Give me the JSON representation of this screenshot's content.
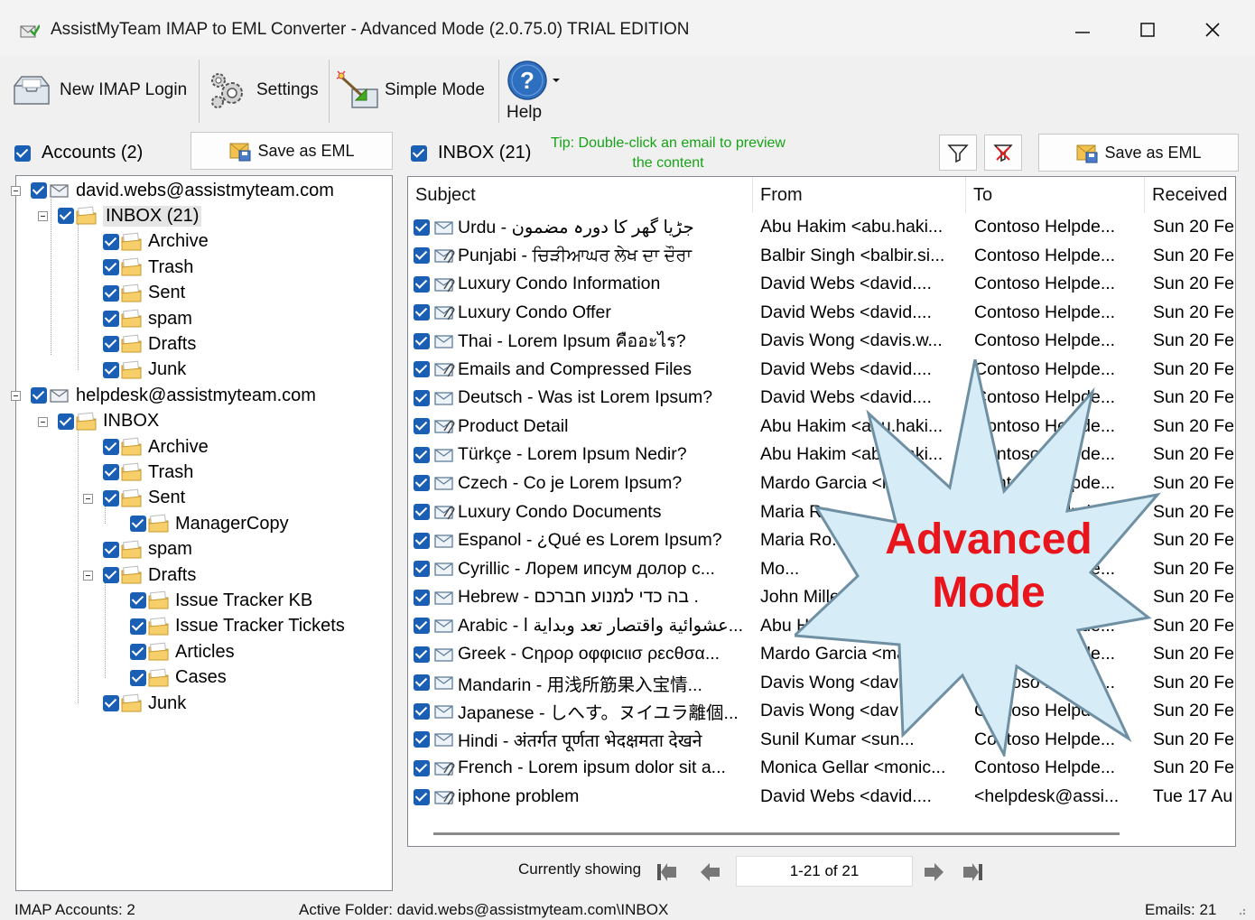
{
  "window": {
    "title": "AssistMyTeam IMAP to EML Converter - Advanced Mode (2.0.75.0) TRIAL EDITION"
  },
  "toolbar": {
    "new_imap_login": "New IMAP Login",
    "settings": "Settings",
    "simple_mode": "Simple Mode",
    "help": "Help"
  },
  "accounts_panel": {
    "header": "Accounts (2)",
    "save_label": "Save as EML",
    "tree": [
      {
        "label": "david.webs@assistmyteam.com",
        "level": 0,
        "kind": "account"
      },
      {
        "label": "INBOX (21)",
        "level": 1,
        "kind": "folder",
        "selected": true
      },
      {
        "label": "Archive",
        "level": 2,
        "kind": "folder"
      },
      {
        "label": "Trash",
        "level": 2,
        "kind": "folder"
      },
      {
        "label": "Sent",
        "level": 2,
        "kind": "folder"
      },
      {
        "label": "spam",
        "level": 2,
        "kind": "folder"
      },
      {
        "label": "Drafts",
        "level": 2,
        "kind": "folder"
      },
      {
        "label": "Junk",
        "level": 2,
        "kind": "folder"
      },
      {
        "label": "helpdesk@assistmyteam.com",
        "level": 0,
        "kind": "account"
      },
      {
        "label": "INBOX",
        "level": 1,
        "kind": "folder"
      },
      {
        "label": "Archive",
        "level": 2,
        "kind": "folder"
      },
      {
        "label": "Trash",
        "level": 2,
        "kind": "folder"
      },
      {
        "label": "Sent",
        "level": 2,
        "kind": "folder"
      },
      {
        "label": "ManagerCopy",
        "level": 3,
        "kind": "folder"
      },
      {
        "label": "spam",
        "level": 2,
        "kind": "folder"
      },
      {
        "label": "Drafts",
        "level": 2,
        "kind": "folder"
      },
      {
        "label": "Issue Tracker KB",
        "level": 3,
        "kind": "folder"
      },
      {
        "label": "Issue Tracker Tickets",
        "level": 3,
        "kind": "folder"
      },
      {
        "label": "Articles",
        "level": 3,
        "kind": "folder"
      },
      {
        "label": "Cases",
        "level": 3,
        "kind": "folder"
      },
      {
        "label": "Junk",
        "level": 2,
        "kind": "folder"
      }
    ]
  },
  "inbox_panel": {
    "header": "INBOX (21)",
    "tip": "Tip: Double-click an email to preview the content",
    "save_label": "Save as EML",
    "columns": [
      "Subject",
      "From",
      "To",
      "Received"
    ],
    "rows": [
      {
        "subject": "Urdu - جڑیا گھر کا دورہ مضمون",
        "from": "Abu Hakim <abu.haki...",
        "to": "Contoso Helpde...",
        "received": "Sun 20 Fe",
        "attach": false
      },
      {
        "subject": "Punjabi - ਚਿੜੀਆਘਰ ਲੇਖ ਦਾ ਦੌਰਾ",
        "from": "Balbir Singh <balbir.si...",
        "to": "Contoso Helpde...",
        "received": "Sun 20 Fe",
        "attach": true
      },
      {
        "subject": "Luxury Condo Information",
        "from": "David Webs <david....",
        "to": "Contoso Helpde...",
        "received": "Sun 20 Fe",
        "attach": true
      },
      {
        "subject": "Luxury Condo Offer",
        "from": "David Webs <david....",
        "to": "Contoso Helpde...",
        "received": "Sun 20 Fe",
        "attach": true
      },
      {
        "subject": "Thai - Lorem Ipsum คืออะไร?",
        "from": "Davis Wong <davis.w...",
        "to": "Contoso Helpde...",
        "received": "Sun 20 Fe",
        "attach": false
      },
      {
        "subject": "Emails and Compressed Files",
        "from": "David Webs <david....",
        "to": "Contoso Helpde...",
        "received": "Sun 20 Fe",
        "attach": true
      },
      {
        "subject": "Deutsch - Was ist Lorem Ipsum?",
        "from": "David Webs <david....",
        "to": "Contoso Helpde...",
        "received": "Sun 20 Fe",
        "attach": false
      },
      {
        "subject": "Product Detail",
        "from": "Abu Hakim <abu.haki...",
        "to": "Contoso Helpde...",
        "received": "Sun 20 Fe",
        "attach": true
      },
      {
        "subject": "Türkçe - Lorem Ipsum Nedir?",
        "from": "Abu Hakim <abu.haki...",
        "to": "Contoso Helpde...",
        "received": "Sun 20 Fe",
        "attach": false
      },
      {
        "subject": "Czech - Co je Lorem Ipsum?",
        "from": "Mardo Garcia <mar...",
        "to": "Contoso Helpde...",
        "received": "Sun 20 Fe",
        "attach": false
      },
      {
        "subject": "Luxury Condo Documents",
        "from": "Maria Ro...",
        "to": "Contoso Helpde...",
        "received": "Sun 20 Fe",
        "attach": true
      },
      {
        "subject": "Espanol - ¿Qué es Lorem Ipsum?",
        "from": "Maria Ro...",
        "to": "Contoso Helpde...",
        "received": "Sun 20 Fe",
        "attach": false
      },
      {
        "subject": "Cyrillic - Лорем ипсум долор с...",
        "from": "Mo...",
        "to": "Contoso Helpde...",
        "received": "Sun 20 Fe",
        "attach": false
      },
      {
        "subject": "Hebrew - בה כדי למנוע חברכם .",
        "from": "John Miller",
        "to": "Contoso Helpde...",
        "received": "Sun 20 Fe",
        "attach": false
      },
      {
        "subject": "Arabic - عشوائية واقتصار تعد وبداية ا...",
        "from": "Abu Hakim",
        "to": "Contoso Helpde...",
        "received": "Sun 20 Fe",
        "attach": false
      },
      {
        "subject": "Greek - Cηρορ οφφιcιισ ρεcθσα...",
        "from": "Mardo Garcia <mar",
        "to": "Contoso Helpde...",
        "received": "Sun 20 Fe",
        "attach": false
      },
      {
        "subject": "Mandarin - 用浅所筋果入宝情...",
        "from": "Davis Wong <davi",
        "to": "Contoso Helpde...",
        "received": "Sun 20 Fe",
        "attach": false
      },
      {
        "subject": "Japanese - しへす。ヌイユラ離個...",
        "from": "Davis Wong <dav",
        "to": "Contoso Helpde...",
        "received": "Sun 20 Fe",
        "attach": false
      },
      {
        "subject": "Hindi - अंतर्गत पूर्णता भेदक्षमता देखने",
        "from": "Sunil Kumar <sun...",
        "to": "Contoso Helpde...",
        "received": "Sun 20 Fe",
        "attach": false
      },
      {
        "subject": "French - Lorem ipsum dolor sit a...",
        "from": "Monica Gellar <monic...",
        "to": "Contoso Helpde...",
        "received": "Sun 20 Fe",
        "attach": true
      },
      {
        "subject": "iphone problem",
        "from": "David Webs <david....",
        "to": "<helpdesk@assi...",
        "received": "Tue 17 Au",
        "attach": true
      }
    ]
  },
  "pager": {
    "currently_showing": "Currently showing",
    "range": "1-21 of 21"
  },
  "badge": {
    "line1": "Advanced",
    "line2": "Mode"
  },
  "status": {
    "accounts": "IMAP Accounts: 2",
    "folder": "Active Folder: david.webs@assistmyteam.com\\INBOX",
    "emails": "Emails: 21"
  },
  "colors": {
    "checkbox": "#1a5fb4",
    "tip_text": "#17a317",
    "badge_fill": "#d6ecf6",
    "badge_text": "#e8161c",
    "folder": "#f2c14e"
  }
}
